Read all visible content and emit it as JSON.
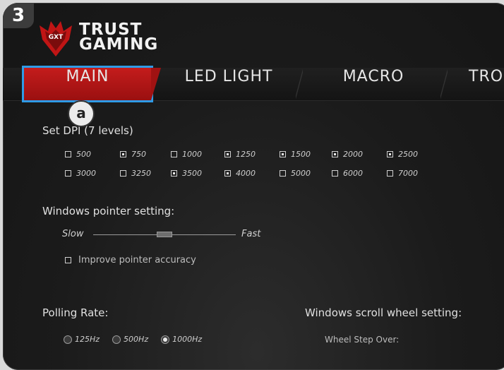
{
  "step_badge": "3",
  "step_marker": "a",
  "logo": {
    "line1": "TRUST",
    "line2": "GAMING"
  },
  "tabs": [
    {
      "label": "MAIN",
      "active": true
    },
    {
      "label": "LED LIGHT",
      "active": false
    },
    {
      "label": "MACRO",
      "active": false
    },
    {
      "label": "TRO",
      "active": false
    }
  ],
  "dpi": {
    "title": "Set DPI (7 levels)",
    "row1": [
      {
        "label": "500",
        "checked": false
      },
      {
        "label": "750",
        "checked": true
      },
      {
        "label": "1000",
        "checked": false
      },
      {
        "label": "1250",
        "checked": true
      },
      {
        "label": "1500",
        "checked": true
      },
      {
        "label": "2000",
        "checked": true
      },
      {
        "label": "2500",
        "checked": true
      }
    ],
    "row2": [
      {
        "label": "3000",
        "checked": false
      },
      {
        "label": "3250",
        "checked": false
      },
      {
        "label": "3500",
        "checked": true
      },
      {
        "label": "4000",
        "checked": true
      },
      {
        "label": "5000",
        "checked": false
      },
      {
        "label": "6000",
        "checked": false
      },
      {
        "label": "7000",
        "checked": false
      }
    ]
  },
  "pointer": {
    "title": "Windows pointer setting:",
    "slow": "Slow",
    "fast": "Fast",
    "speed_fraction": 0.5,
    "accuracy_label": "Improve pointer accuracy",
    "accuracy_checked": false
  },
  "polling": {
    "title": "Polling Rate:",
    "options": [
      {
        "label": "125Hz",
        "selected": false
      },
      {
        "label": "500Hz",
        "selected": false
      },
      {
        "label": "1000Hz",
        "selected": true
      }
    ]
  },
  "scroll": {
    "title": "Windows scroll wheel setting:",
    "step_over": "Wheel Step Over:"
  },
  "colors": {
    "accent_red": "#b31616",
    "highlight_blue": "#2f9be6"
  }
}
